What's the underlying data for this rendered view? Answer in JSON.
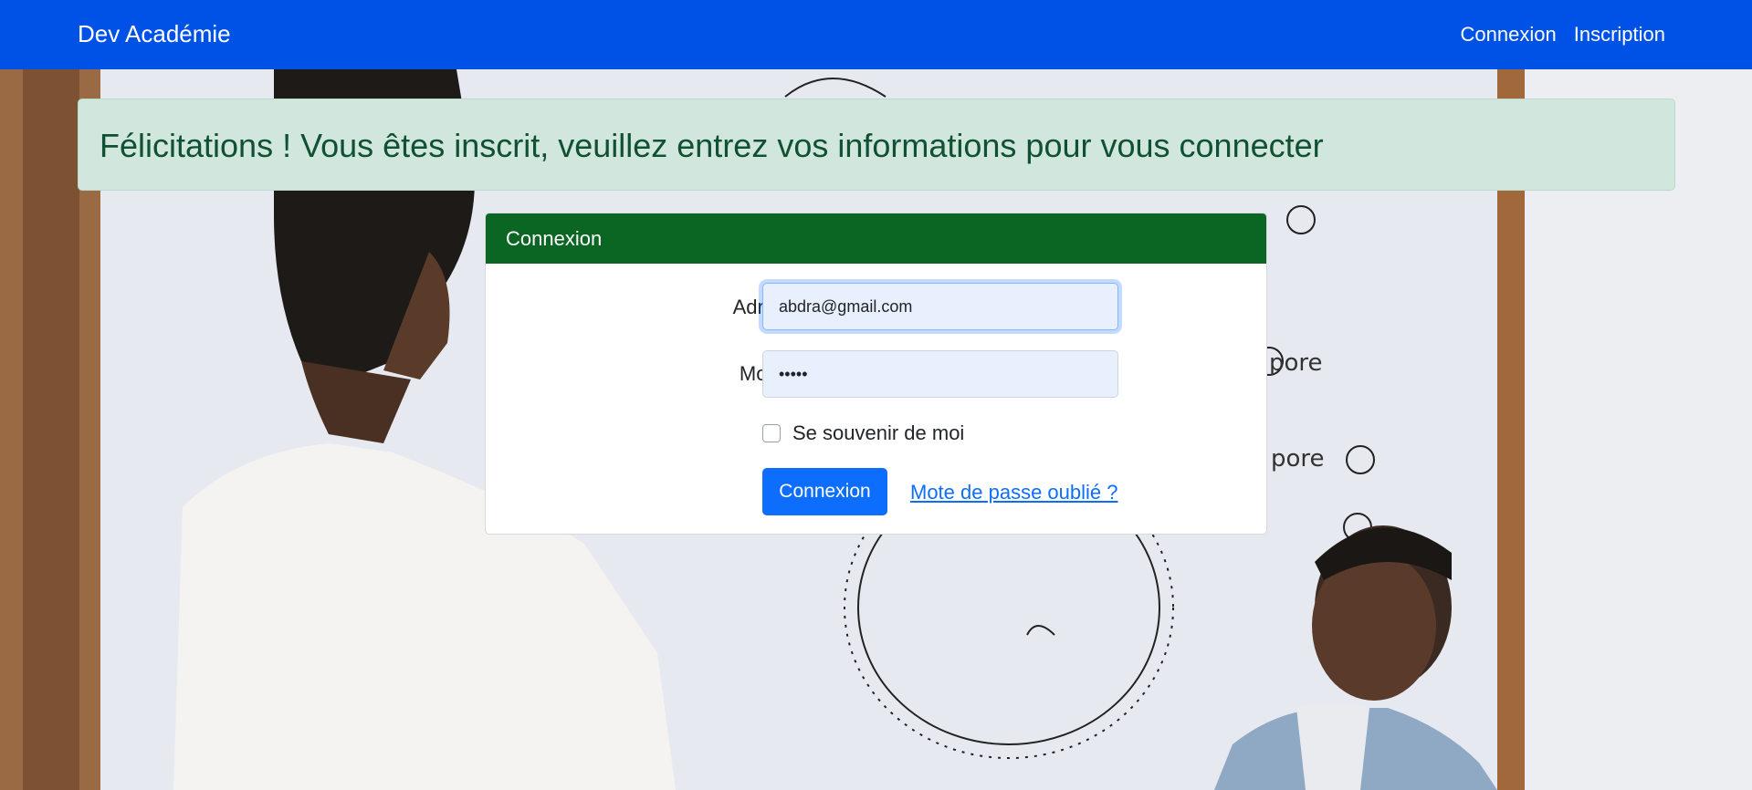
{
  "navbar": {
    "brand": "Dev Académie",
    "links": [
      "Connexion",
      "Inscription"
    ]
  },
  "alert": {
    "message": "Félicitations ! Vous êtes inscrit, veuillez entrez vos informations pour vous connecter"
  },
  "login_card": {
    "title": "Connexion",
    "email_label": "Adresse email",
    "email_value": "abdra@gmail.com",
    "password_label": "Mot de passe",
    "password_value": "•••••",
    "remember_label": "Se souvenir de moi",
    "submit_label": "Connexion",
    "forgot_link": "Mote de passe oublié ?"
  },
  "colors": {
    "navbar": "#0052e6",
    "card_header": "#0b6623",
    "alert_bg": "#d1e7dd",
    "alert_text": "#0f5132",
    "primary": "#0d6efd"
  }
}
